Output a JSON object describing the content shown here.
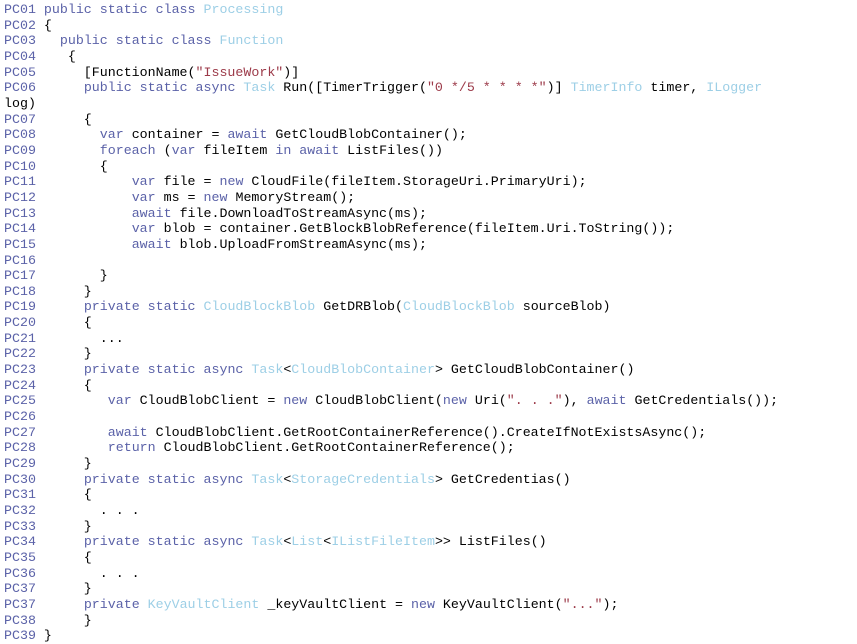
{
  "document": {
    "kind": "source-code-listing",
    "language": "C#",
    "line_number_prefix": "PC",
    "colors": {
      "background": "#ffffff",
      "default_text": "#000000",
      "line_number": "#5b62a8",
      "keyword": "#5b62a8",
      "type": "#9dcfe6",
      "string": "#9c3a49"
    },
    "lines": [
      {
        "num": "PC01",
        "tokens": [
          {
            "t": "kw",
            "v": "public static class "
          },
          {
            "t": "type",
            "v": "Processing"
          }
        ]
      },
      {
        "num": "PC02",
        "tokens": [
          {
            "t": "plain",
            "v": "{"
          }
        ]
      },
      {
        "num": "PC03",
        "tokens": [
          {
            "t": "plain",
            "v": "  "
          },
          {
            "t": "kw",
            "v": "public static class "
          },
          {
            "t": "type",
            "v": "Function"
          }
        ]
      },
      {
        "num": "PC04",
        "tokens": [
          {
            "t": "plain",
            "v": "   {"
          }
        ]
      },
      {
        "num": "PC05",
        "tokens": [
          {
            "t": "plain",
            "v": "     [FunctionName("
          },
          {
            "t": "str",
            "v": "\"IssueWork\""
          },
          {
            "t": "plain",
            "v": ")]"
          }
        ]
      },
      {
        "num": "PC06",
        "tokens": [
          {
            "t": "plain",
            "v": "     "
          },
          {
            "t": "kw",
            "v": "public static async "
          },
          {
            "t": "type",
            "v": "Task"
          },
          {
            "t": "plain",
            "v": " Run([TimerTrigger("
          },
          {
            "t": "str",
            "v": "\"0 */5 * * * *\""
          },
          {
            "t": "plain",
            "v": ")] "
          },
          {
            "t": "type",
            "v": "TimerInfo"
          },
          {
            "t": "plain",
            "v": " timer, "
          },
          {
            "t": "type",
            "v": "ILogger"
          }
        ]
      },
      {
        "num": "",
        "wrap": true,
        "tokens": [
          {
            "t": "plain",
            "v": "log)"
          }
        ]
      },
      {
        "num": "PC07",
        "tokens": [
          {
            "t": "plain",
            "v": "     {"
          }
        ]
      },
      {
        "num": "PC08",
        "tokens": [
          {
            "t": "plain",
            "v": "       "
          },
          {
            "t": "kw",
            "v": "var"
          },
          {
            "t": "plain",
            "v": " container = "
          },
          {
            "t": "kw",
            "v": "await"
          },
          {
            "t": "plain",
            "v": " GetCloudBlobContainer();"
          }
        ]
      },
      {
        "num": "PC09",
        "tokens": [
          {
            "t": "plain",
            "v": "       "
          },
          {
            "t": "kw",
            "v": "foreach"
          },
          {
            "t": "plain",
            "v": " ("
          },
          {
            "t": "kw",
            "v": "var"
          },
          {
            "t": "plain",
            "v": " fileItem "
          },
          {
            "t": "kw",
            "v": "in await"
          },
          {
            "t": "plain",
            "v": " ListFiles())"
          }
        ]
      },
      {
        "num": "PC10",
        "tokens": [
          {
            "t": "plain",
            "v": "       {"
          }
        ]
      },
      {
        "num": "PC11",
        "tokens": [
          {
            "t": "plain",
            "v": "           "
          },
          {
            "t": "kw",
            "v": "var"
          },
          {
            "t": "plain",
            "v": " file = "
          },
          {
            "t": "kw",
            "v": "new"
          },
          {
            "t": "plain",
            "v": " CloudFile(fileItem.StorageUri.PrimaryUri);"
          }
        ]
      },
      {
        "num": "PC12",
        "tokens": [
          {
            "t": "plain",
            "v": "           "
          },
          {
            "t": "kw",
            "v": "var"
          },
          {
            "t": "plain",
            "v": " ms = "
          },
          {
            "t": "kw",
            "v": "new"
          },
          {
            "t": "plain",
            "v": " MemoryStream();"
          }
        ]
      },
      {
        "num": "PC13",
        "tokens": [
          {
            "t": "plain",
            "v": "           "
          },
          {
            "t": "kw",
            "v": "await"
          },
          {
            "t": "plain",
            "v": " file.DownloadToStreamAsync(ms);"
          }
        ]
      },
      {
        "num": "PC14",
        "tokens": [
          {
            "t": "plain",
            "v": "           "
          },
          {
            "t": "kw",
            "v": "var"
          },
          {
            "t": "plain",
            "v": " blob = container.GetBlockBlobReference(fileItem.Uri.ToString());"
          }
        ]
      },
      {
        "num": "PC15",
        "tokens": [
          {
            "t": "plain",
            "v": "           "
          },
          {
            "t": "kw",
            "v": "await"
          },
          {
            "t": "plain",
            "v": " blob.UploadFromStreamAsync(ms);"
          }
        ]
      },
      {
        "num": "PC16",
        "tokens": [
          {
            "t": "plain",
            "v": ""
          }
        ]
      },
      {
        "num": "PC17",
        "tokens": [
          {
            "t": "plain",
            "v": "       }"
          }
        ]
      },
      {
        "num": "PC18",
        "tokens": [
          {
            "t": "plain",
            "v": "     }"
          }
        ]
      },
      {
        "num": "PC19",
        "tokens": [
          {
            "t": "plain",
            "v": "     "
          },
          {
            "t": "kw",
            "v": "private static "
          },
          {
            "t": "type",
            "v": "CloudBlockBlob"
          },
          {
            "t": "plain",
            "v": " GetDRBlob("
          },
          {
            "t": "type",
            "v": "CloudBlockBlob"
          },
          {
            "t": "plain",
            "v": " sourceBlob)"
          }
        ]
      },
      {
        "num": "PC20",
        "tokens": [
          {
            "t": "plain",
            "v": "     {"
          }
        ]
      },
      {
        "num": "PC21",
        "tokens": [
          {
            "t": "plain",
            "v": "       ..."
          }
        ]
      },
      {
        "num": "PC22",
        "tokens": [
          {
            "t": "plain",
            "v": "     }"
          }
        ]
      },
      {
        "num": "PC23",
        "tokens": [
          {
            "t": "plain",
            "v": "     "
          },
          {
            "t": "kw",
            "v": "private static async "
          },
          {
            "t": "type",
            "v": "Task"
          },
          {
            "t": "plain",
            "v": "<"
          },
          {
            "t": "type",
            "v": "CloudBlobContainer"
          },
          {
            "t": "plain",
            "v": "> GetCloudBlobContainer()"
          }
        ]
      },
      {
        "num": "PC24",
        "tokens": [
          {
            "t": "plain",
            "v": "     {"
          }
        ]
      },
      {
        "num": "PC25",
        "tokens": [
          {
            "t": "plain",
            "v": "        "
          },
          {
            "t": "kw",
            "v": "var"
          },
          {
            "t": "plain",
            "v": " CloudBlobClient = "
          },
          {
            "t": "kw",
            "v": "new"
          },
          {
            "t": "plain",
            "v": " CloudBlobClient("
          },
          {
            "t": "kw",
            "v": "new"
          },
          {
            "t": "plain",
            "v": " Uri("
          },
          {
            "t": "str",
            "v": "\". . .\""
          },
          {
            "t": "plain",
            "v": "), "
          },
          {
            "t": "kw",
            "v": "await"
          },
          {
            "t": "plain",
            "v": " GetCredentials());"
          }
        ]
      },
      {
        "num": "PC26",
        "tokens": [
          {
            "t": "plain",
            "v": ""
          }
        ]
      },
      {
        "num": "PC27",
        "tokens": [
          {
            "t": "plain",
            "v": "        "
          },
          {
            "t": "kw",
            "v": "await"
          },
          {
            "t": "plain",
            "v": " CloudBlobClient.GetRootContainerReference().CreateIfNotExistsAsync();"
          }
        ]
      },
      {
        "num": "PC28",
        "tokens": [
          {
            "t": "plain",
            "v": "        "
          },
          {
            "t": "kw",
            "v": "return"
          },
          {
            "t": "plain",
            "v": " CloudBlobClient.GetRootContainerReference();"
          }
        ]
      },
      {
        "num": "PC29",
        "tokens": [
          {
            "t": "plain",
            "v": "     }"
          }
        ]
      },
      {
        "num": "PC30",
        "tokens": [
          {
            "t": "plain",
            "v": "     "
          },
          {
            "t": "kw",
            "v": "private static async "
          },
          {
            "t": "type",
            "v": "Task"
          },
          {
            "t": "plain",
            "v": "<"
          },
          {
            "t": "type",
            "v": "StorageCredentials"
          },
          {
            "t": "plain",
            "v": "> GetCredentias()"
          }
        ]
      },
      {
        "num": "PC31",
        "tokens": [
          {
            "t": "plain",
            "v": "     {"
          }
        ]
      },
      {
        "num": "PC32",
        "tokens": [
          {
            "t": "plain",
            "v": "       . . ."
          }
        ]
      },
      {
        "num": "PC33",
        "tokens": [
          {
            "t": "plain",
            "v": "     }"
          }
        ]
      },
      {
        "num": "PC34",
        "tokens": [
          {
            "t": "plain",
            "v": "     "
          },
          {
            "t": "kw",
            "v": "private static async "
          },
          {
            "t": "type",
            "v": "Task"
          },
          {
            "t": "plain",
            "v": "<"
          },
          {
            "t": "type",
            "v": "List"
          },
          {
            "t": "plain",
            "v": "<"
          },
          {
            "t": "type",
            "v": "IListFileItem"
          },
          {
            "t": "plain",
            "v": ">> ListFiles()"
          }
        ]
      },
      {
        "num": "PC35",
        "tokens": [
          {
            "t": "plain",
            "v": "     {"
          }
        ]
      },
      {
        "num": "PC36",
        "tokens": [
          {
            "t": "plain",
            "v": "       . . ."
          }
        ]
      },
      {
        "num": "PC37",
        "tokens": [
          {
            "t": "plain",
            "v": "     }"
          }
        ]
      },
      {
        "num": "PC37",
        "tokens": [
          {
            "t": "plain",
            "v": "     "
          },
          {
            "t": "kw",
            "v": "private "
          },
          {
            "t": "type",
            "v": "KeyVaultClient"
          },
          {
            "t": "plain",
            "v": " _keyVaultClient = "
          },
          {
            "t": "kw",
            "v": "new"
          },
          {
            "t": "plain",
            "v": " KeyVaultClient("
          },
          {
            "t": "str",
            "v": "\"...\""
          },
          {
            "t": "plain",
            "v": ");"
          }
        ]
      },
      {
        "num": "PC38",
        "tokens": [
          {
            "t": "plain",
            "v": "     }"
          }
        ]
      },
      {
        "num": "PC39",
        "tokens": [
          {
            "t": "plain",
            "v": "}"
          }
        ]
      }
    ]
  }
}
